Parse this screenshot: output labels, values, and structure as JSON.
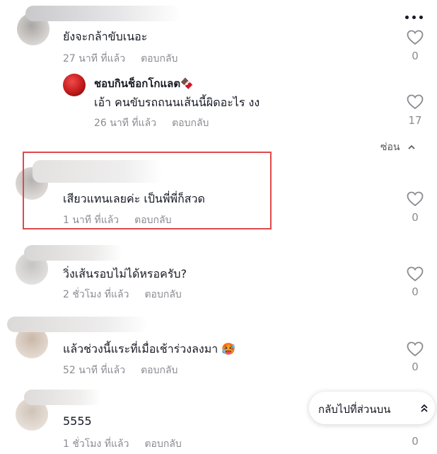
{
  "icons": {
    "more": "more-horizontal-icon",
    "heart": "heart-outline-icon",
    "chevron_up": "chevron-up-icon",
    "double_chevron_up": "double-chevron-up-icon"
  },
  "colors": {
    "highlight_border": "#e0494b",
    "meta_text": "#8a8b91"
  },
  "comments": [
    {
      "text": "ยังจะกล้าขับเนอะ",
      "time": "27 นาที ที่แล้ว",
      "reply": "ตอบกลับ",
      "likes": "0"
    },
    {
      "author": "ชอบกินช็อกโกแลต🍫",
      "text": "เอ้า คนขับรถถนนเส้นนี้ผิดอะไร งง",
      "time": "26 นาที ที่แล้ว",
      "reply": "ตอบกลับ",
      "likes": "17"
    },
    {
      "text": "เสียวแทนเลยค่ะ เป็นพี่พี่ก็สวด",
      "time": "1 นาที ที่แล้ว",
      "reply": "ตอบกลับ",
      "likes": "0"
    },
    {
      "text": "วิ่งเส้นรอบไม่ได้หรอครับ?",
      "time": "2 ชั่วโมง ที่แล้ว",
      "reply": "ตอบกลับ",
      "likes": "0"
    },
    {
      "text": "แล้วช่วงนี้แระที่เมื่อเช้าร่วงลงมา 🥵",
      "time": "52 นาที ที่แล้ว",
      "reply": "ตอบกลับ",
      "likes": "0"
    },
    {
      "text": "5555",
      "time": "1 ชั่วโมง ที่แล้ว",
      "reply": "ตอบกลับ",
      "likes": "0"
    }
  ],
  "hide_replies": "ซ่อน",
  "back_to_top": "กลับไปที่ส่วนบน"
}
